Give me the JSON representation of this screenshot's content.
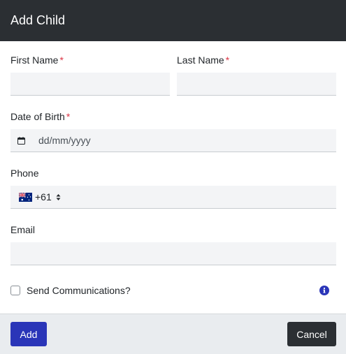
{
  "modal": {
    "title": "Add Child"
  },
  "form": {
    "first_name": {
      "label": "First Name",
      "required": "*",
      "value": ""
    },
    "last_name": {
      "label": "Last Name",
      "required": "*",
      "value": ""
    },
    "dob": {
      "label": "Date of Birth",
      "required": "*",
      "placeholder": "dd/mm/yyyy"
    },
    "phone": {
      "label": "Phone",
      "country_code": "+61",
      "country_flag": "australia-flag-icon",
      "value": ""
    },
    "email": {
      "label": "Email",
      "value": ""
    },
    "send_comms": {
      "label": "Send Communications?",
      "checked": false,
      "info_icon": "info-icon"
    }
  },
  "footer": {
    "add_label": "Add",
    "cancel_label": "Cancel"
  },
  "colors": {
    "header_bg": "#2b2f33",
    "required": "#dc3545",
    "primary": "#2a35b8",
    "info": "#2a35b8"
  }
}
